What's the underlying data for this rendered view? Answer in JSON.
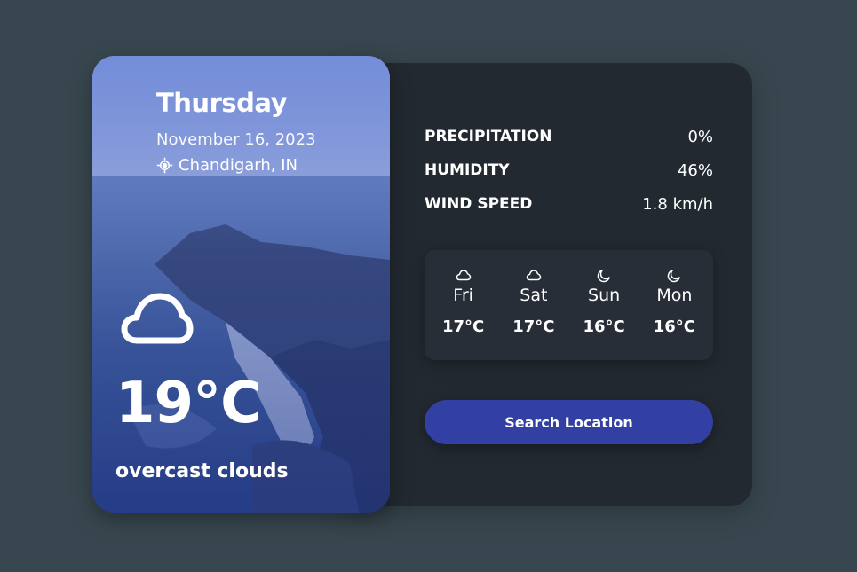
{
  "current": {
    "day": "Thursday",
    "date": "November 16, 2023",
    "location": "Chandigarh, IN",
    "temperature": "19°C",
    "description": "overcast clouds",
    "icon": "cloud-icon"
  },
  "stats": [
    {
      "label": "PRECIPITATION",
      "value": "0%"
    },
    {
      "label": "HUMIDITY",
      "value": "46%"
    },
    {
      "label": "WIND SPEED",
      "value": "1.8 km/h"
    }
  ],
  "forecast": [
    {
      "day": "Fri",
      "temp": "17°C",
      "icon": "cloud-icon"
    },
    {
      "day": "Sat",
      "temp": "17°C",
      "icon": "cloud-icon"
    },
    {
      "day": "Sun",
      "temp": "16°C",
      "icon": "moon-icon"
    },
    {
      "day": "Mon",
      "temp": "16°C",
      "icon": "moon-icon"
    }
  ],
  "search_button": {
    "label": "Search Location"
  },
  "colors": {
    "page_bg": "#38474f",
    "panel_bg": "#232931",
    "forecast_bg": "#272e37",
    "button_bg": "#3340a3"
  }
}
